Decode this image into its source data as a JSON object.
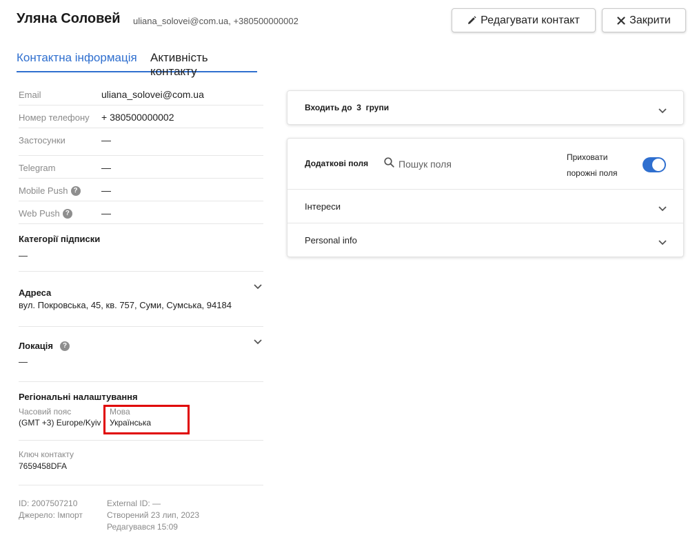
{
  "header": {
    "name": "Уляна Соловей",
    "subtitle": "uliana_solovei@com.ua, +380500000002",
    "edit_label": "Редагувати контакт",
    "close_label": "Закрити"
  },
  "tabs": {
    "contact_info": "Контактна інформація",
    "activity": "Активність контакту"
  },
  "channels": [
    {
      "label": "Email",
      "value": "uliana_solovei@com.ua"
    },
    {
      "label": "Номер телефону",
      "value": "+ 380500000002"
    },
    {
      "label": "Застосунки",
      "value": "—"
    },
    {
      "label": "Telegram",
      "value": "—"
    },
    {
      "label": "Mobile Push",
      "value": "—"
    },
    {
      "label": "Web Push",
      "value": "—"
    }
  ],
  "subscription": {
    "title": "Категорії підписки",
    "value": "—"
  },
  "address": {
    "title": "Адреса",
    "value": "вул. Покровська, 45, кв. 757, Суми, Сумська, 94184"
  },
  "location": {
    "title": "Локація",
    "value": "—"
  },
  "regional": {
    "title": "Регіональні налаштування",
    "timezone_label": "Часовий пояс",
    "timezone_value": "(GMT +3) Europe/Kyiv",
    "language_label": "Мова",
    "language_value": "Українська"
  },
  "contact_key": {
    "label": "Ключ контакту",
    "value": "7659458DFA"
  },
  "meta": {
    "id": "ID: 2007507210",
    "source": "Джерело:  Імпорт",
    "external_id": "External ID: —",
    "created": "Створений 23 лип, 2023",
    "edited": "Редагувався 15:09"
  },
  "groups": {
    "prefix": "Входить до",
    "count": "3",
    "suffix": "групи"
  },
  "additional_fields": {
    "title": "Додаткові поля",
    "search_placeholder": "Пошук поля",
    "hide_empty_line1": "Приховати",
    "hide_empty_line2": "порожні поля",
    "hide_empty_enabled": true,
    "items": [
      {
        "name": "Інтереси"
      },
      {
        "name": "Personal info"
      }
    ]
  },
  "colors": {
    "accent": "#2f6fcf",
    "highlight": "#e00000"
  }
}
